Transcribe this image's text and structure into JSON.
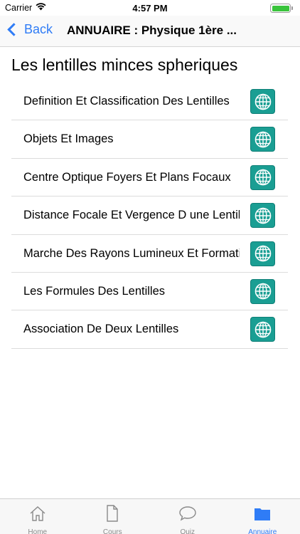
{
  "status": {
    "carrier": "Carrier",
    "time": "4:57 PM"
  },
  "nav": {
    "back_label": "Back",
    "title": "ANNUAIRE : Physique 1ère ..."
  },
  "section_title": "Les lentilles minces spheriques",
  "items": [
    {
      "label": "Definition Et Classification Des Lentilles",
      "icon": "globe-icon"
    },
    {
      "label": "Objets Et Images",
      "icon": "globe-icon"
    },
    {
      "label": "Centre Optique Foyers Et Plans Focaux",
      "icon": "globe-icon"
    },
    {
      "label": "Distance Focale Et Vergence D une Lentille",
      "icon": "globe-icon"
    },
    {
      "label": "Marche Des Rayons Lumineux Et Formation",
      "icon": "globe-icon"
    },
    {
      "label": "Les Formules Des Lentilles",
      "icon": "globe-icon"
    },
    {
      "label": "Association De Deux Lentilles",
      "icon": "globe-icon"
    }
  ],
  "tabs": [
    {
      "label": "Home",
      "icon": "home-icon",
      "active": false
    },
    {
      "label": "Cours",
      "icon": "document-icon",
      "active": false
    },
    {
      "label": "Quiz",
      "icon": "chat-bubble-icon",
      "active": false
    },
    {
      "label": "Annuaire",
      "icon": "folder-icon",
      "active": true
    }
  ],
  "colors": {
    "accent": "#2f7cf6",
    "globe_button": "#1a9e93",
    "battery": "#39c43c"
  }
}
